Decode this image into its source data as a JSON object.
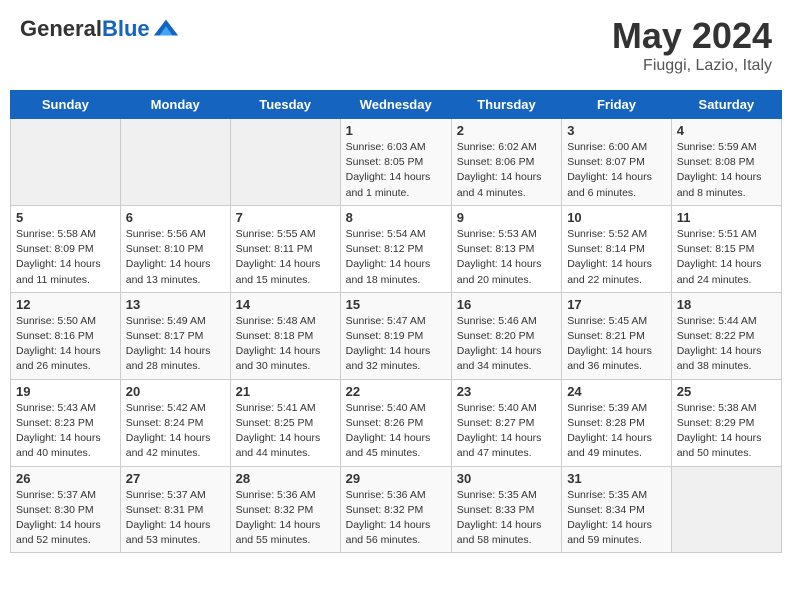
{
  "header": {
    "logo_general": "General",
    "logo_blue": "Blue",
    "month_title": "May 2024",
    "location": "Fiuggi, Lazio, Italy"
  },
  "days_of_week": [
    "Sunday",
    "Monday",
    "Tuesday",
    "Wednesday",
    "Thursday",
    "Friday",
    "Saturday"
  ],
  "weeks": [
    [
      {
        "day": "",
        "info": ""
      },
      {
        "day": "",
        "info": ""
      },
      {
        "day": "",
        "info": ""
      },
      {
        "day": "1",
        "info": "Sunrise: 6:03 AM\nSunset: 8:05 PM\nDaylight: 14 hours\nand 1 minute."
      },
      {
        "day": "2",
        "info": "Sunrise: 6:02 AM\nSunset: 8:06 PM\nDaylight: 14 hours\nand 4 minutes."
      },
      {
        "day": "3",
        "info": "Sunrise: 6:00 AM\nSunset: 8:07 PM\nDaylight: 14 hours\nand 6 minutes."
      },
      {
        "day": "4",
        "info": "Sunrise: 5:59 AM\nSunset: 8:08 PM\nDaylight: 14 hours\nand 8 minutes."
      }
    ],
    [
      {
        "day": "5",
        "info": "Sunrise: 5:58 AM\nSunset: 8:09 PM\nDaylight: 14 hours\nand 11 minutes."
      },
      {
        "day": "6",
        "info": "Sunrise: 5:56 AM\nSunset: 8:10 PM\nDaylight: 14 hours\nand 13 minutes."
      },
      {
        "day": "7",
        "info": "Sunrise: 5:55 AM\nSunset: 8:11 PM\nDaylight: 14 hours\nand 15 minutes."
      },
      {
        "day": "8",
        "info": "Sunrise: 5:54 AM\nSunset: 8:12 PM\nDaylight: 14 hours\nand 18 minutes."
      },
      {
        "day": "9",
        "info": "Sunrise: 5:53 AM\nSunset: 8:13 PM\nDaylight: 14 hours\nand 20 minutes."
      },
      {
        "day": "10",
        "info": "Sunrise: 5:52 AM\nSunset: 8:14 PM\nDaylight: 14 hours\nand 22 minutes."
      },
      {
        "day": "11",
        "info": "Sunrise: 5:51 AM\nSunset: 8:15 PM\nDaylight: 14 hours\nand 24 minutes."
      }
    ],
    [
      {
        "day": "12",
        "info": "Sunrise: 5:50 AM\nSunset: 8:16 PM\nDaylight: 14 hours\nand 26 minutes."
      },
      {
        "day": "13",
        "info": "Sunrise: 5:49 AM\nSunset: 8:17 PM\nDaylight: 14 hours\nand 28 minutes."
      },
      {
        "day": "14",
        "info": "Sunrise: 5:48 AM\nSunset: 8:18 PM\nDaylight: 14 hours\nand 30 minutes."
      },
      {
        "day": "15",
        "info": "Sunrise: 5:47 AM\nSunset: 8:19 PM\nDaylight: 14 hours\nand 32 minutes."
      },
      {
        "day": "16",
        "info": "Sunrise: 5:46 AM\nSunset: 8:20 PM\nDaylight: 14 hours\nand 34 minutes."
      },
      {
        "day": "17",
        "info": "Sunrise: 5:45 AM\nSunset: 8:21 PM\nDaylight: 14 hours\nand 36 minutes."
      },
      {
        "day": "18",
        "info": "Sunrise: 5:44 AM\nSunset: 8:22 PM\nDaylight: 14 hours\nand 38 minutes."
      }
    ],
    [
      {
        "day": "19",
        "info": "Sunrise: 5:43 AM\nSunset: 8:23 PM\nDaylight: 14 hours\nand 40 minutes."
      },
      {
        "day": "20",
        "info": "Sunrise: 5:42 AM\nSunset: 8:24 PM\nDaylight: 14 hours\nand 42 minutes."
      },
      {
        "day": "21",
        "info": "Sunrise: 5:41 AM\nSunset: 8:25 PM\nDaylight: 14 hours\nand 44 minutes."
      },
      {
        "day": "22",
        "info": "Sunrise: 5:40 AM\nSunset: 8:26 PM\nDaylight: 14 hours\nand 45 minutes."
      },
      {
        "day": "23",
        "info": "Sunrise: 5:40 AM\nSunset: 8:27 PM\nDaylight: 14 hours\nand 47 minutes."
      },
      {
        "day": "24",
        "info": "Sunrise: 5:39 AM\nSunset: 8:28 PM\nDaylight: 14 hours\nand 49 minutes."
      },
      {
        "day": "25",
        "info": "Sunrise: 5:38 AM\nSunset: 8:29 PM\nDaylight: 14 hours\nand 50 minutes."
      }
    ],
    [
      {
        "day": "26",
        "info": "Sunrise: 5:37 AM\nSunset: 8:30 PM\nDaylight: 14 hours\nand 52 minutes."
      },
      {
        "day": "27",
        "info": "Sunrise: 5:37 AM\nSunset: 8:31 PM\nDaylight: 14 hours\nand 53 minutes."
      },
      {
        "day": "28",
        "info": "Sunrise: 5:36 AM\nSunset: 8:32 PM\nDaylight: 14 hours\nand 55 minutes."
      },
      {
        "day": "29",
        "info": "Sunrise: 5:36 AM\nSunset: 8:32 PM\nDaylight: 14 hours\nand 56 minutes."
      },
      {
        "day": "30",
        "info": "Sunrise: 5:35 AM\nSunset: 8:33 PM\nDaylight: 14 hours\nand 58 minutes."
      },
      {
        "day": "31",
        "info": "Sunrise: 5:35 AM\nSunset: 8:34 PM\nDaylight: 14 hours\nand 59 minutes."
      },
      {
        "day": "",
        "info": ""
      }
    ]
  ]
}
